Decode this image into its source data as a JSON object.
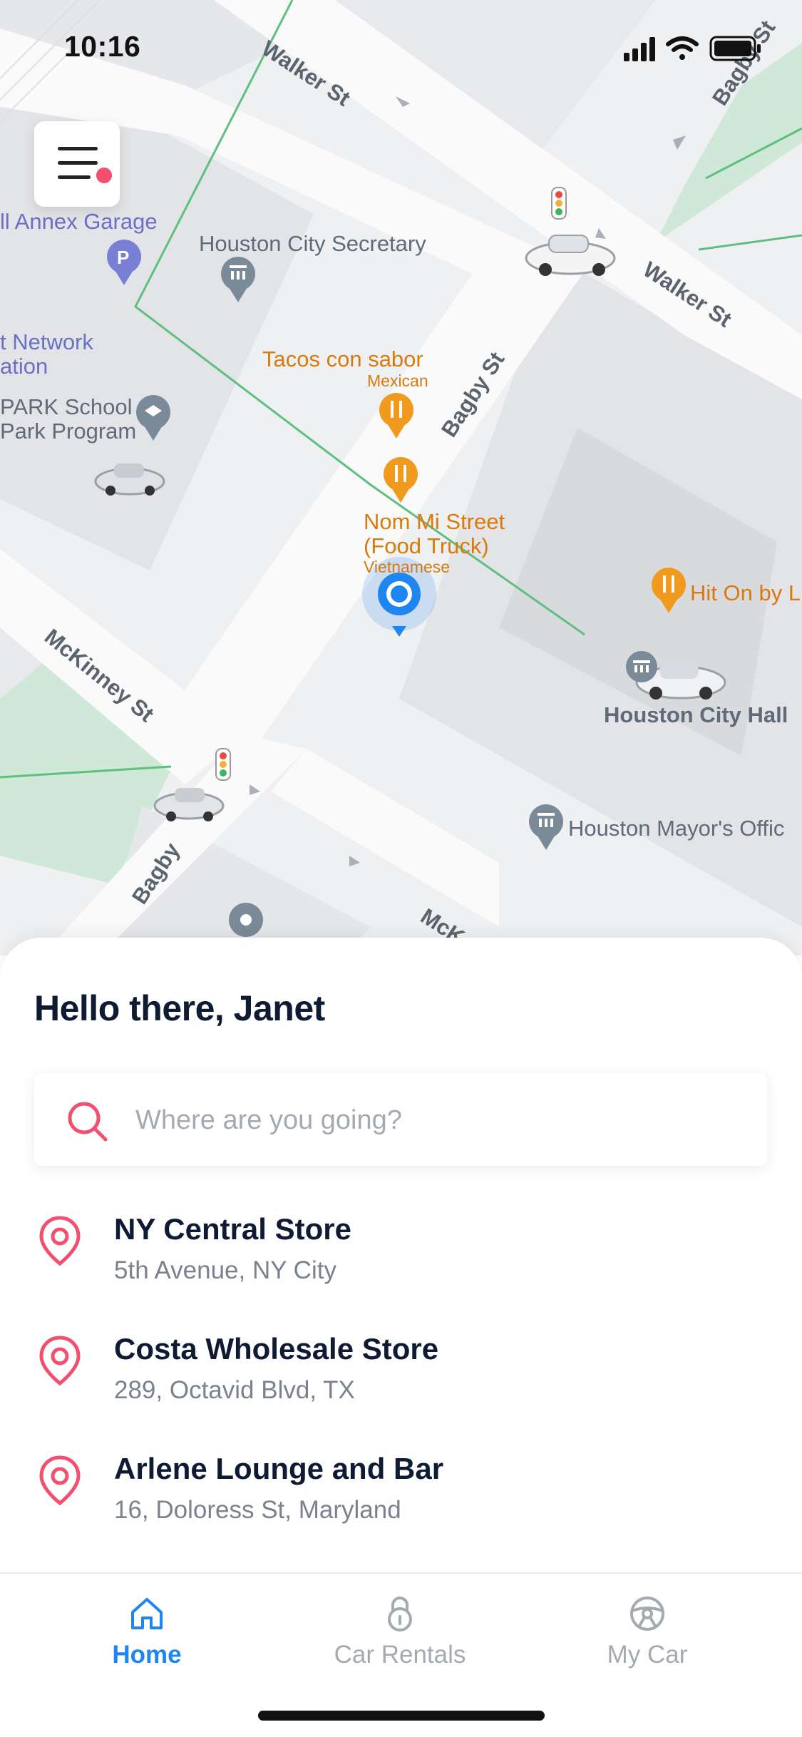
{
  "status_bar": {
    "time": "10:16"
  },
  "map": {
    "streets": {
      "walker_top": "Walker St",
      "walker_right": "Walker St",
      "bagby_center": "Bagby St",
      "bagby_top_right": "Bagby St",
      "bagby_bottom": "Bagby",
      "mckinney_left": "McKinney St",
      "mckinney_bottom": "McK"
    },
    "places": {
      "annex_garage": "ll Annex Garage",
      "city_secretary": "Houston City Secretary",
      "network_line1": "t Network",
      "network_line2": "ation",
      "park_school_line1": "PARK School",
      "park_school_line2": "Park Program",
      "tacos_name": "Tacos con sabor",
      "tacos_type": "Mexican",
      "nom_mi_line1": "Nom Mi Street",
      "nom_mi_line2": "(Food Truck)",
      "nom_mi_type": "Vietnamese",
      "hit_on": "Hit On by L",
      "city_hall": "Houston City Hall",
      "mayors_office": "Houston Mayor's Offic"
    }
  },
  "menu": {
    "icon": "menu-icon",
    "notification": true
  },
  "sheet": {
    "greeting": "Hello there, Janet",
    "search": {
      "placeholder": "Where are you going?",
      "value": ""
    },
    "recent_places": [
      {
        "name": "NY Central Store",
        "address": "5th Avenue, NY City"
      },
      {
        "name": "Costa Wholesale Store",
        "address": "289, Octavid Blvd, TX"
      },
      {
        "name": "Arlene Lounge and Bar",
        "address": "16, Doloress St, Maryland"
      }
    ]
  },
  "tabs": [
    {
      "label": "Home",
      "icon": "home-icon",
      "active": true
    },
    {
      "label": "Car Rentals",
      "icon": "lock-icon",
      "active": false
    },
    {
      "label": "My Car",
      "icon": "steering-wheel-icon",
      "active": false
    }
  ],
  "colors": {
    "accent_blue": "#1f85f0",
    "pin_pink": "#f2506e",
    "text_dark": "#0f1b33",
    "text_muted": "#7b828e",
    "poi_orange": "#f09a1e",
    "park_green": "#cfe8d7"
  }
}
